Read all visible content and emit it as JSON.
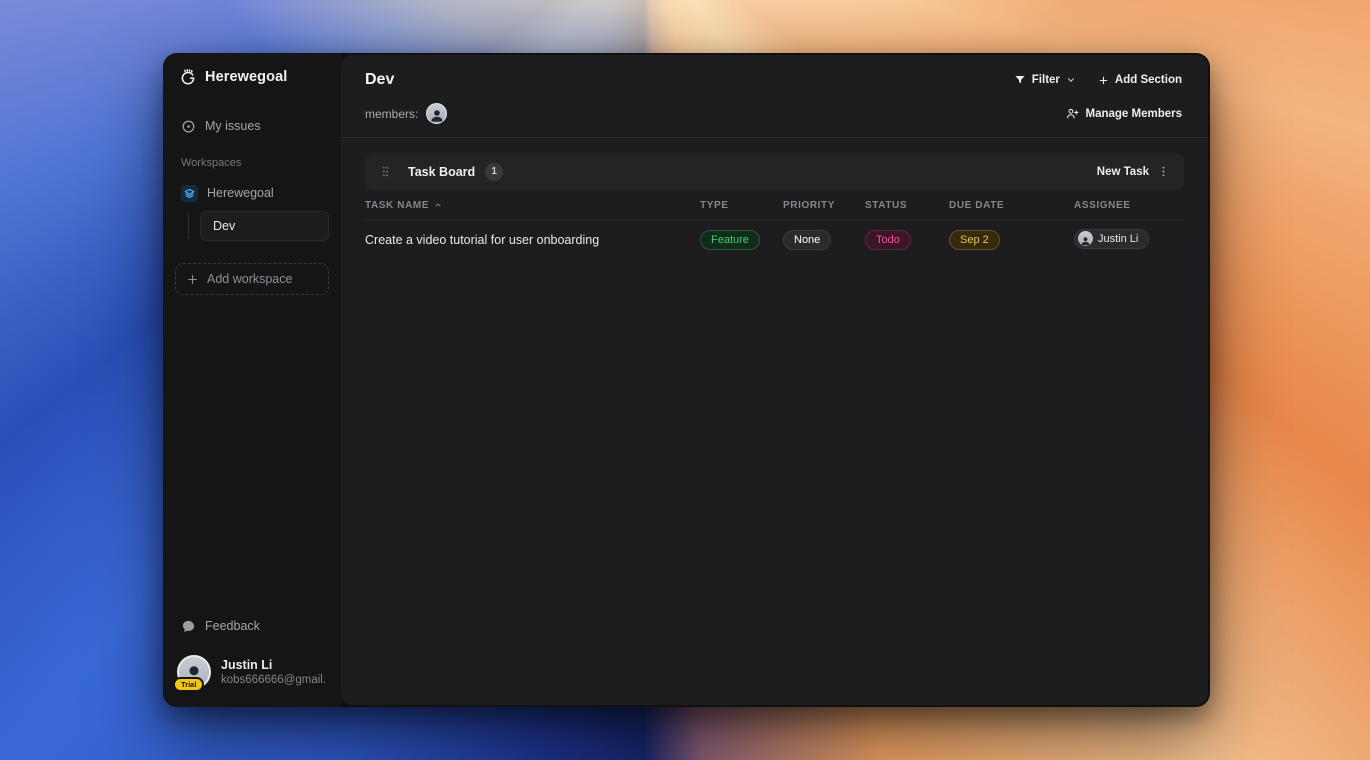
{
  "sidebar": {
    "brand": "Herewegoal",
    "my_issues_label": "My issues",
    "workspaces_label": "Workspaces",
    "workspace_name": "Herewegoal",
    "project_name": "Dev",
    "add_workspace_label": "Add workspace",
    "feedback_label": "Feedback",
    "user": {
      "name": "Justin Li",
      "email": "kobs666666@gmail....",
      "plan": "Trial"
    }
  },
  "header": {
    "title": "Dev",
    "filter_label": "Filter",
    "add_section_label": "Add Section",
    "members_label": "members:",
    "manage_members_label": "Manage Members"
  },
  "board": {
    "section_title": "Task Board",
    "task_count": "1",
    "new_task_label": "New Task",
    "columns": [
      "TASK NAME",
      "TYPE",
      "PRIORITY",
      "STATUS",
      "DUE DATE",
      "ASSIGNEE"
    ],
    "rows": [
      {
        "name": "Create a video tutorial for user onboarding",
        "type": "Feature",
        "priority": "None",
        "status": "Todo",
        "due_date": "Sep 2",
        "assignee": "Justin Li"
      }
    ]
  },
  "colors": {
    "type_feature_text": "#3ecf6f",
    "status_todo_text": "#f0559b",
    "due_date_text": "#eec33f",
    "workspace_icon_accent": "#4db2f0",
    "trial_badge_bg": "#f2c516"
  },
  "icons": {
    "logo": "fist-logo",
    "my_issues": "circle-dot",
    "workspace": "layers",
    "filter": "funnel",
    "manage_members": "user-plus",
    "feedback": "speech-bubble"
  }
}
